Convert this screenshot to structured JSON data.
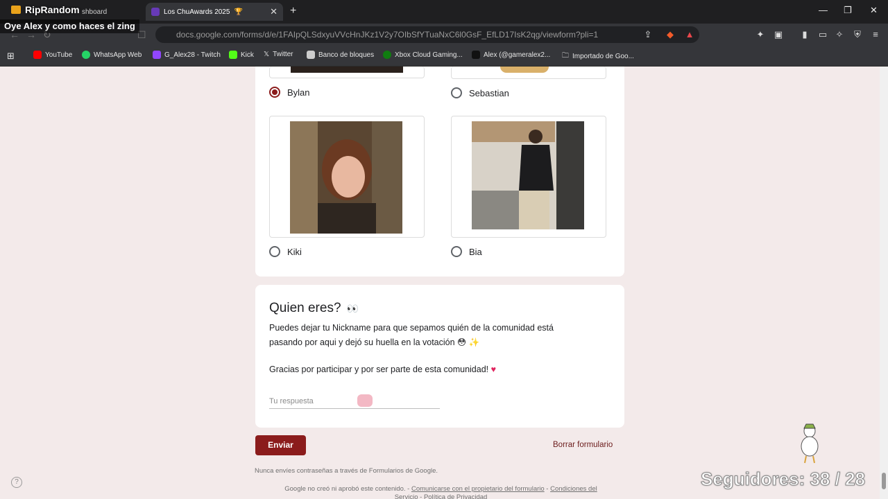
{
  "browser": {
    "tabs": [
      {
        "label": "shboard",
        "active": false
      },
      {
        "label": "Los ChuAwards 2025",
        "active": true
      }
    ],
    "url": "docs.google.com/forms/d/e/1FAIpQLSdxyuVVcHnJKz1V2y7OIbSfYTuaNxC6l0GsF_EfLD17IsK2qg/viewform?pli=1",
    "bookmarks": [
      {
        "label": "YouTube",
        "color": "#ff0000"
      },
      {
        "label": "WhatsApp Web",
        "color": "#25d366"
      },
      {
        "label": "G_Alex28 - Twitch",
        "color": "#9146ff"
      },
      {
        "label": "Kick",
        "color": "#53fc18"
      },
      {
        "label": "Twitter",
        "color": "#111111"
      },
      {
        "label": "Banco de bloques",
        "color": "#cccccc"
      },
      {
        "label": "Xbox Cloud Gaming...",
        "color": "#107c10"
      },
      {
        "label": "Alex (@gameralex2...",
        "color": "#111111"
      },
      {
        "label": "Importado de Goo...",
        "color": "#888888"
      }
    ]
  },
  "stream": {
    "channel": "RipRandom",
    "overlay_message": "Oye Alex y como haces el zing",
    "followers_text": "Seguidores: 38 / 28"
  },
  "form": {
    "options": [
      {
        "label": "Bylan",
        "selected": true
      },
      {
        "label": "Sebastian",
        "selected": false
      },
      {
        "label": "Kiki",
        "selected": false
      },
      {
        "label": "Bia",
        "selected": false
      }
    ],
    "question": {
      "title": "Quien eres?",
      "desc_line1": "Puedes dejar tu Nickname para que sepamos quién de la comunidad está",
      "desc_line2": "pasando por aqui y dejó su huella en la votación",
      "thanks": "Gracias por participar y por ser parte de esta comunidad!",
      "placeholder": "Tu respuesta"
    },
    "submit_label": "Enviar",
    "clear_label": "Borrar formulario",
    "footer_warning": "Nunca envíes contraseñas a través de Formularios de Google.",
    "footer_prefix": "Google no creó ni aprobó este contenido. -",
    "footer_link1": "Comunicarse con el propietario del formulario",
    "footer_link2": "Condiciones del Servicio",
    "footer_link3": "Política de Privacidad"
  },
  "colors": {
    "accent": "#8b1c1c",
    "page_bg": "#f3eaea"
  }
}
